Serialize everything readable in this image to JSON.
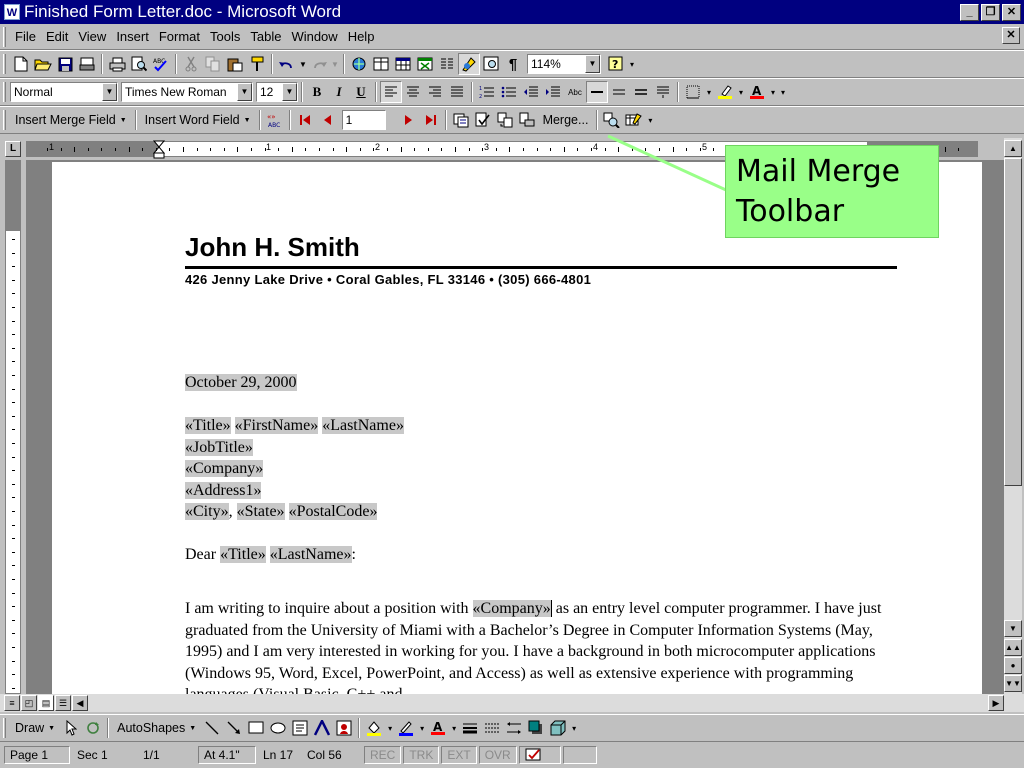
{
  "window": {
    "title": "Finished Form Letter.doc - Microsoft Word",
    "app_icon": "W",
    "controls": [
      "_",
      "❐",
      "✕"
    ]
  },
  "menu": {
    "items": [
      "File",
      "Edit",
      "View",
      "Insert",
      "Format",
      "Tools",
      "Table",
      "Window",
      "Help"
    ],
    "doc_close": "✕"
  },
  "standard_toolbar": {
    "zoom": "114%"
  },
  "formatting_toolbar": {
    "style": "Normal",
    "font": "Times New Roman",
    "size": "12",
    "bold": "B",
    "italic": "I",
    "underline": "U"
  },
  "mail_merge_toolbar": {
    "insert_merge_field": "Insert Merge Field",
    "insert_word_field": "Insert Word Field",
    "record_number": "1",
    "merge_button": "Merge..."
  },
  "ruler": {
    "numbers": [
      "1",
      "1",
      "2",
      "3",
      "4",
      "5"
    ]
  },
  "letter": {
    "name": "John H. Smith",
    "address": "426 Jenny Lake Drive • Coral Gables, FL  33146 • (305) 666-4801",
    "date": "October 29, 2000",
    "fields": {
      "title": "«Title»",
      "first_name": "«FirstName»",
      "last_name": "«LastName»",
      "job_title": "«JobTitle»",
      "company": "«Company»",
      "address1": "«Address1»",
      "city": "«City»",
      "state": "«State»",
      "postal_code": "«PostalCode»"
    },
    "dear": "Dear",
    "colon": ":",
    "comma": ",",
    "body_before": "I am writing to inquire about a position with",
    "body_after": " as an entry level computer programmer.  I have just graduated from the University of Miami with a Bachelor’s Degree in Computer Information Systems (May, 1995) and I am very interested in working for you.  I have a background in both microcomputer applications (Windows 95, Word, Excel, PowerPoint, and Access) as well as extensive experience with programming languages (Visual Basic, C++ and"
  },
  "drawing_toolbar": {
    "draw": "Draw",
    "autoshapes": "AutoShapes"
  },
  "status_bar": {
    "page": "Page 1",
    "sec": "Sec 1",
    "pages": "1/1",
    "at": "At 4.1\"",
    "ln": "Ln 17",
    "col": "Col 56",
    "rec": "REC",
    "trk": "TRK",
    "ext": "EXT",
    "ovr": "OVR"
  },
  "callout": {
    "line1": "Mail Merge",
    "line2": "Toolbar",
    "color": "#99ff88"
  }
}
